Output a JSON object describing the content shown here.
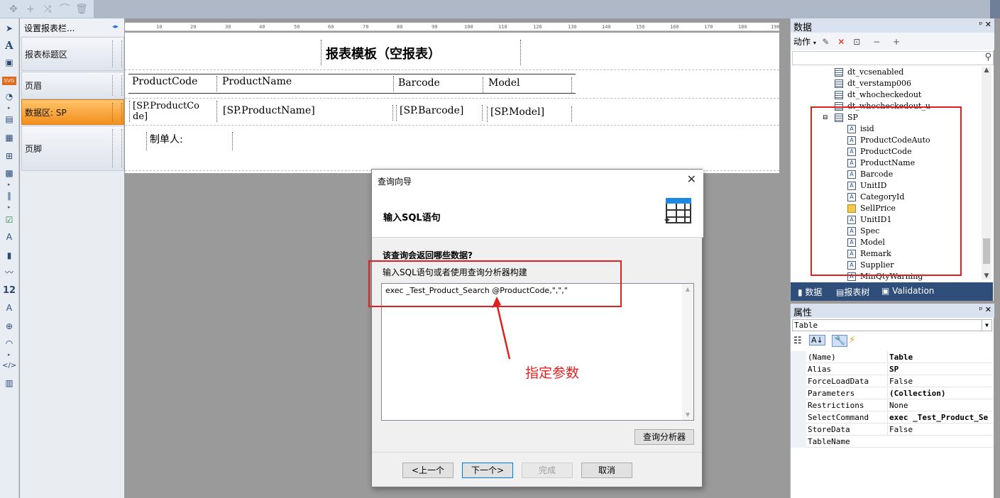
{
  "toolbar": {
    "icons": [
      "move-icon",
      "add-icon",
      "shuffle-icon",
      "link-icon",
      "delete-icon"
    ]
  },
  "band_panel": {
    "header": "设置报表栏...",
    "bands": [
      {
        "label": "报表标题区",
        "active": false
      },
      {
        "label": "页眉",
        "active": false
      },
      {
        "label": "数据区: SP",
        "active": true
      },
      {
        "label": "页脚",
        "active": false
      }
    ]
  },
  "ruler": {
    "ticks": [
      "10",
      "20",
      "30",
      "40",
      "50",
      "60",
      "70",
      "80",
      "90",
      "100",
      "110",
      "120",
      "130",
      "140",
      "150",
      "160",
      "170",
      "180",
      "190"
    ]
  },
  "design": {
    "title": "报表模板（空报表）",
    "headers": [
      "ProductCode",
      "ProductName",
      "Barcode",
      "Model"
    ],
    "data_fields": [
      "[SP.ProductCo\nde]",
      "[SP.ProductName]",
      "[SP.Barcode]",
      "[SP.Model]"
    ],
    "footer_label": "制单人:"
  },
  "data_panel": {
    "title": "数据",
    "pins": "ᵖ ✕",
    "actions_label": "动作",
    "tree": [
      {
        "label": "dt_vcsenabled",
        "type": "table"
      },
      {
        "label": "dt_verstamp006",
        "type": "table"
      },
      {
        "label": "dt_whocheckedout",
        "type": "table"
      },
      {
        "label": "dt_whocheckedout_u",
        "type": "table"
      },
      {
        "label": "SP",
        "type": "table-open"
      },
      {
        "label": "isid",
        "type": "text"
      },
      {
        "label": "ProductCodeAuto",
        "type": "text"
      },
      {
        "label": "ProductCode",
        "type": "text"
      },
      {
        "label": "ProductName",
        "type": "text"
      },
      {
        "label": "Barcode",
        "type": "text"
      },
      {
        "label": "UnitID",
        "type": "text"
      },
      {
        "label": "CategoryId",
        "type": "text"
      },
      {
        "label": "SellPrice",
        "type": "money"
      },
      {
        "label": "UnitID1",
        "type": "text"
      },
      {
        "label": "Spec",
        "type": "text"
      },
      {
        "label": "Model",
        "type": "text"
      },
      {
        "label": "Remark",
        "type": "text"
      },
      {
        "label": "Supplier",
        "type": "text"
      },
      {
        "label": "MinQtyWarning",
        "type": "text"
      }
    ],
    "tabs": [
      "数据",
      "报表树",
      "Validation"
    ]
  },
  "properties": {
    "title": "属性",
    "object": "Table",
    "rows": [
      {
        "key": "(Name)",
        "value": "Table",
        "bold": true
      },
      {
        "key": "Alias",
        "value": "SP",
        "bold": true
      },
      {
        "key": "ForceLoadData",
        "value": "False",
        "bold": false
      },
      {
        "key": "Parameters",
        "value": "(Collection)",
        "bold": true
      },
      {
        "key": "Restrictions",
        "value": "None",
        "bold": false
      },
      {
        "key": "SelectCommand",
        "value": "exec _Test_Product_Se",
        "bold": true
      },
      {
        "key": "StoreData",
        "value": "False",
        "bold": false
      },
      {
        "key": "TableName",
        "value": "",
        "bold": false
      }
    ]
  },
  "dialog": {
    "title": "查询向导",
    "step_title": "输入SQL语句",
    "question": "该查询会返回哪些数据?",
    "hint": "输入SQL语句或者使用查询分析器构建",
    "sql": "exec _Test_Product_Search @ProductCode,\",\",\"",
    "analyzer_button": "查询分析器",
    "back_button": "<上一个",
    "next_button": "下一个>",
    "finish_button": "完成",
    "cancel_button": "取消"
  },
  "annotation": {
    "text": "指定参数",
    "color": "#e02020"
  }
}
